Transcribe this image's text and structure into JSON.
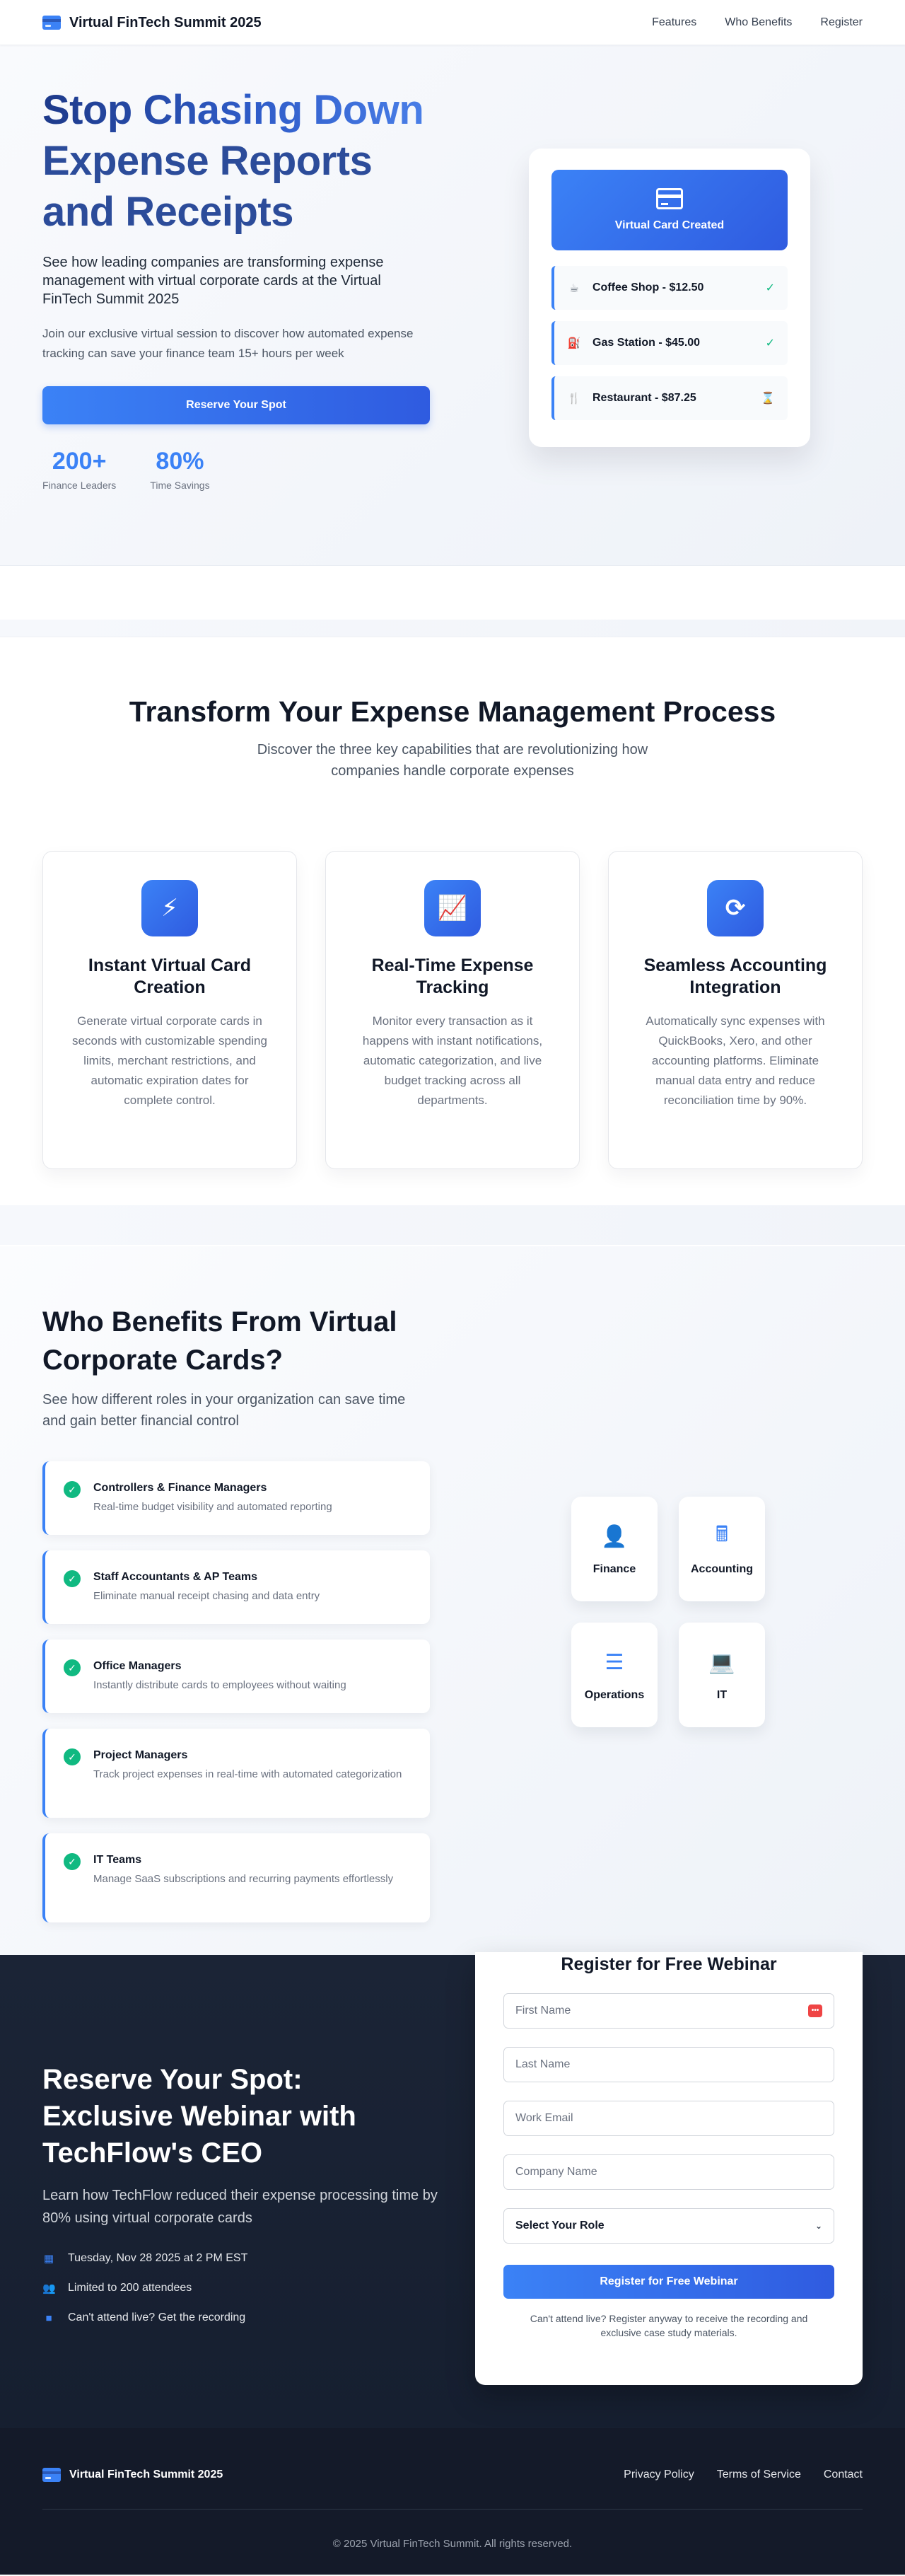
{
  "nav": {
    "brand": "Virtual FinTech Summit 2025",
    "links": [
      "Features",
      "Who Benefits",
      "Register"
    ]
  },
  "hero": {
    "title_line1": "Stop Chasing Down",
    "title_line2": "Expense Reports",
    "title_line3": "and Receipts",
    "subtitle": "See how leading companies are transforming expense management with virtual corporate cards at the Virtual FinTech Summit 2025",
    "description": "Join our exclusive virtual session to discover how automated expense tracking can save your finance team 15+ hours per week",
    "cta": "Reserve Your Spot",
    "stats": [
      {
        "value": "200+",
        "label": "Finance Leaders"
      },
      {
        "value": "80%",
        "label": "Time Savings"
      }
    ],
    "card": {
      "banner": "Virtual Card Created",
      "transactions": [
        {
          "icon": "coffee-icon",
          "label": "Coffee Shop - $12.50",
          "status": "✓",
          "state": "ok"
        },
        {
          "icon": "gas-pump-icon",
          "label": "Gas Station - $45.00",
          "status": "✓",
          "state": "ok"
        },
        {
          "icon": "utensils-icon",
          "label": "Restaurant - $87.25",
          "status": "⌛",
          "state": "pending"
        }
      ]
    }
  },
  "process": {
    "title": "Transform Your Expense Management Process",
    "subtitle": "Discover the three key capabilities that are revolutionizing how companies handle corporate expenses",
    "features": [
      {
        "icon": "bolt-icon",
        "glyph": "⚡",
        "title": "Instant Virtual Card Creation",
        "desc": "Generate virtual corporate cards in seconds with customizable spending limits, merchant restrictions, and automatic expiration dates for complete control."
      },
      {
        "icon": "chart-line-icon",
        "glyph": "📈",
        "title": "Real-Time Expense Tracking",
        "desc": "Monitor every transaction as it happens with instant notifications, automatic categorization, and live budget tracking across all departments."
      },
      {
        "icon": "sync-icon",
        "glyph": "⟳",
        "title": "Seamless Accounting Integration",
        "desc": "Automatically sync expenses with QuickBooks, Xero, and other accounting platforms. Eliminate manual data entry and reduce reconciliation time by 90%."
      }
    ]
  },
  "benefits": {
    "title": "Who Benefits From Virtual Corporate Cards?",
    "subtitle": "See how different roles in your organization can save time and gain better financial control",
    "items": [
      {
        "title": "Controllers & Finance Managers",
        "desc": "Real-time budget visibility and automated reporting"
      },
      {
        "title": "Staff Accountants & AP Teams",
        "desc": "Eliminate manual receipt chasing and data entry"
      },
      {
        "title": "Office Managers",
        "desc": "Instantly distribute cards to employees without waiting"
      },
      {
        "title": "Project Managers",
        "desc": "Track project expenses in real-time with automated categorization"
      },
      {
        "title": "IT Teams",
        "desc": "Manage SaaS subscriptions and recurring payments effortlessly"
      }
    ],
    "roles": [
      {
        "icon": "user-tie-icon",
        "glyph": "👤",
        "label": "Finance"
      },
      {
        "icon": "calculator-icon",
        "glyph": "🖩",
        "label": "Accounting"
      },
      {
        "icon": "tasks-icon",
        "glyph": "☰",
        "label": "Operations"
      },
      {
        "icon": "laptop-code-icon",
        "glyph": "💻",
        "label": "IT"
      }
    ]
  },
  "register": {
    "title": "Reserve Your Spot: Exclusive Webinar with TechFlow's CEO",
    "subtitle": "Learn how TechFlow reduced their expense processing time by 80% using virtual corporate cards",
    "details": [
      {
        "icon": "calendar-icon",
        "glyph": "▦",
        "text": "Tuesday, Nov 28 2025 at 2 PM EST"
      },
      {
        "icon": "users-icon",
        "glyph": "👥",
        "text": "Limited to 200 attendees"
      },
      {
        "icon": "video-icon",
        "glyph": "■",
        "text": "Can't attend live? Get the recording"
      }
    ],
    "form": {
      "title": "Register for Free Webinar",
      "first_name": "First Name",
      "last_name": "Last Name",
      "email": "Work Email",
      "company": "Company Name",
      "role_select": "Select Your Role",
      "submit": "Register for Free Webinar",
      "note": "Can't attend live? Register anyway to receive the recording and exclusive case study materials."
    }
  },
  "footer": {
    "brand": "Virtual FinTech Summit 2025",
    "links": [
      "Privacy Policy",
      "Terms of Service",
      "Contact"
    ],
    "copyright": "© 2025 Virtual FinTech Summit. All rights reserved."
  },
  "colors": {
    "accent": "#3b82f6",
    "accent_dark": "#2f5be0",
    "success": "#10b981",
    "dark_bg": "#1b2436"
  }
}
